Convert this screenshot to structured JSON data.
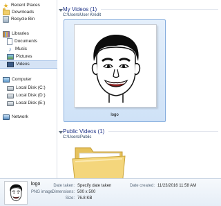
{
  "nav": {
    "favorites": [
      "Recent Places",
      "Downloads",
      "Recycle Bin"
    ],
    "libraries_label": "Libraries",
    "libraries": [
      "Documents",
      "Music",
      "Pictures",
      "Videos"
    ],
    "computer_label": "Computer",
    "drives": [
      "Local Disk (C:)",
      "Local Disk (D:)",
      "Local Disk (E:)"
    ],
    "network_label": "Network",
    "selected": "Videos"
  },
  "groups": [
    {
      "title": "My Videos (1)",
      "path": "C:\\Users\\User Kredit"
    },
    {
      "title": "Public Videos (1)",
      "path": "C:\\Users\\Public"
    }
  ],
  "item": {
    "label": "logo"
  },
  "details": {
    "name": "logo",
    "type": "PNG image",
    "date_taken_label": "Date taken:",
    "date_taken_value": "Specify date taken",
    "dimensions_label": "Dimensions:",
    "dimensions_value": "500 x 500",
    "size_label": "Size:",
    "size_value": "76.8 KB",
    "date_created_label": "Date created:",
    "date_created_value": "11/23/2016 11:58 AM"
  },
  "colors": {
    "accent": "#1e3287",
    "selection": "#d5e3f5",
    "tile_border": "#84acdd",
    "folder": "#f2cf6b"
  },
  "icons": {
    "recent_places": "star-icon",
    "downloads": "folder-icon",
    "recycle_bin": "recycle-bin-icon",
    "libraries": "libraries-icon",
    "computer": "computer-icon",
    "drive": "hard-disk-icon",
    "network": "network-icon"
  }
}
